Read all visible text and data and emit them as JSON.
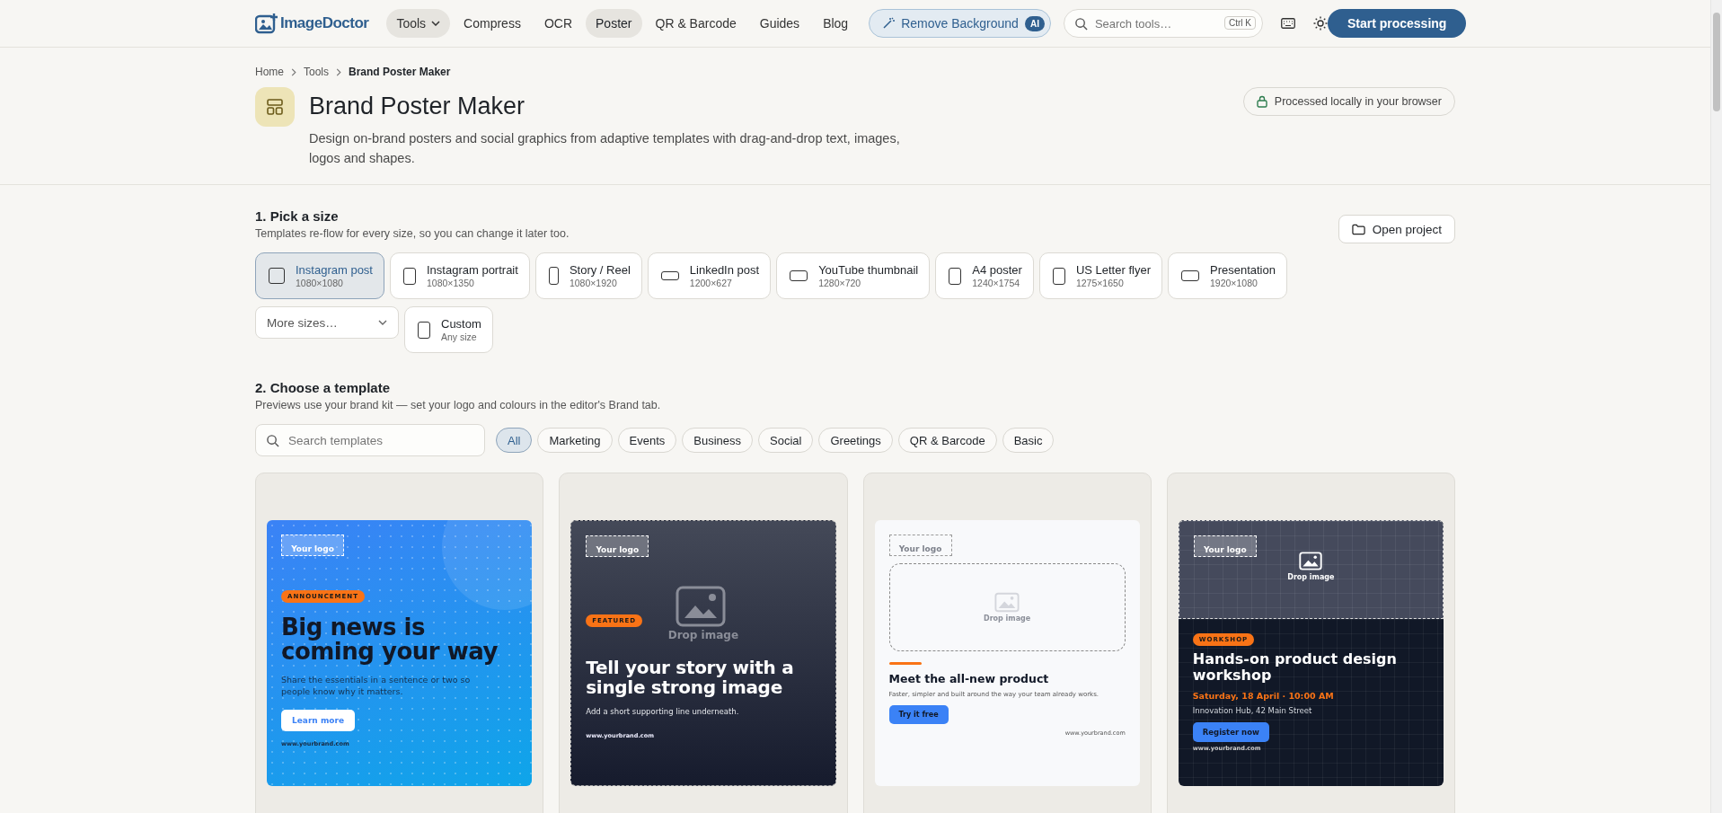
{
  "header": {
    "logo": "ImageDoctor",
    "nav": [
      {
        "label": "Tools",
        "kind": "menu",
        "selected": false
      },
      {
        "label": "Compress",
        "kind": "link",
        "selected": false
      },
      {
        "label": "OCR",
        "kind": "link",
        "selected": false
      },
      {
        "label": "Poster",
        "kind": "link",
        "selected": true
      },
      {
        "label": "QR & Barcode",
        "kind": "link",
        "selected": false
      },
      {
        "label": "Guides",
        "kind": "link",
        "selected": false
      },
      {
        "label": "Blog",
        "kind": "link",
        "selected": false
      }
    ],
    "remove_background": {
      "label": "Remove Background",
      "badge": "AI"
    },
    "search": {
      "placeholder": "Search tools…",
      "shortcut": "Ctrl K"
    },
    "cta": "Start processing"
  },
  "breadcrumb": [
    "Home",
    "Tools",
    "Brand Poster Maker"
  ],
  "page": {
    "title": "Brand Poster Maker",
    "description": "Design on-brand posters and social graphics from adaptive templates with drag-and-drop text, images, logos and shapes.",
    "privacy_badge": "Processed locally in your browser"
  },
  "size_section": {
    "heading": "1. Pick a size",
    "subheading": "Templates re-flow for every size, so you can change it later too.",
    "open_project": "Open project",
    "sizes": [
      {
        "name": "Instagram post",
        "dims": "1080×1080",
        "kind": "square",
        "selected": true
      },
      {
        "name": "Instagram portrait",
        "dims": "1080×1350",
        "kind": "portrait",
        "selected": false
      },
      {
        "name": "Story / Reel",
        "dims": "1080×1920",
        "kind": "tall",
        "selected": false
      },
      {
        "name": "LinkedIn post",
        "dims": "1200×627",
        "kind": "wide",
        "selected": false
      },
      {
        "name": "YouTube thumbnail",
        "dims": "1280×720",
        "kind": "landscape",
        "selected": false
      },
      {
        "name": "A4 poster",
        "dims": "1240×1754",
        "kind": "portrait",
        "selected": false
      },
      {
        "name": "US Letter flyer",
        "dims": "1275×1650",
        "kind": "portrait",
        "selected": false
      },
      {
        "name": "Presentation",
        "dims": "1920×1080",
        "kind": "landscape",
        "selected": false
      }
    ],
    "more_sizes": "More sizes…",
    "custom": {
      "name": "Custom",
      "dims": "Any size",
      "kind": "portrait",
      "selected": false
    }
  },
  "template_section": {
    "heading": "2. Choose a template",
    "subheading": "Previews use your brand kit — set your logo and colours in the editor's Brand tab.",
    "search": {
      "placeholder": "Search templates"
    },
    "filters": [
      {
        "label": "All",
        "selected": true
      },
      {
        "label": "Marketing",
        "selected": false
      },
      {
        "label": "Events",
        "selected": false
      },
      {
        "label": "Business",
        "selected": false
      },
      {
        "label": "Social",
        "selected": false
      },
      {
        "label": "Greetings",
        "selected": false
      },
      {
        "label": "QR & Barcode",
        "selected": false
      },
      {
        "label": "Basic",
        "selected": false
      }
    ],
    "templates": [
      {
        "kind": "announcement",
        "logo": "Your logo",
        "tag": "ANNOUNCEMENT",
        "headline": "Big news is coming your way",
        "body": "Share the essentials in a sentence or two so people know why it matters.",
        "cta": "Learn more",
        "url": "www.yourbrand.com"
      },
      {
        "kind": "photo",
        "logo": "Your logo",
        "tag": "FEATURED",
        "drop": "Drop image",
        "headline": "Tell your story with a single strong image",
        "body": "Add a short supporting line underneath.",
        "url": "www.yourbrand.com"
      },
      {
        "kind": "product",
        "logo": "Your logo",
        "drop": "Drop image",
        "headline": "Meet the all-new product",
        "body": "Faster, simpler and built around the way your team already works.",
        "cta": "Try it free",
        "url": "www.yourbrand.com"
      },
      {
        "kind": "event",
        "logo": "Your logo",
        "drop": "Drop image",
        "tag": "WORKSHOP",
        "headline": "Hands-on product design workshop",
        "date": "Saturday, 18 April · 10:00 AM",
        "place": "Innovation Hub, 42 Main Street",
        "cta": "Register now",
        "url": "www.yourbrand.com"
      }
    ]
  }
}
